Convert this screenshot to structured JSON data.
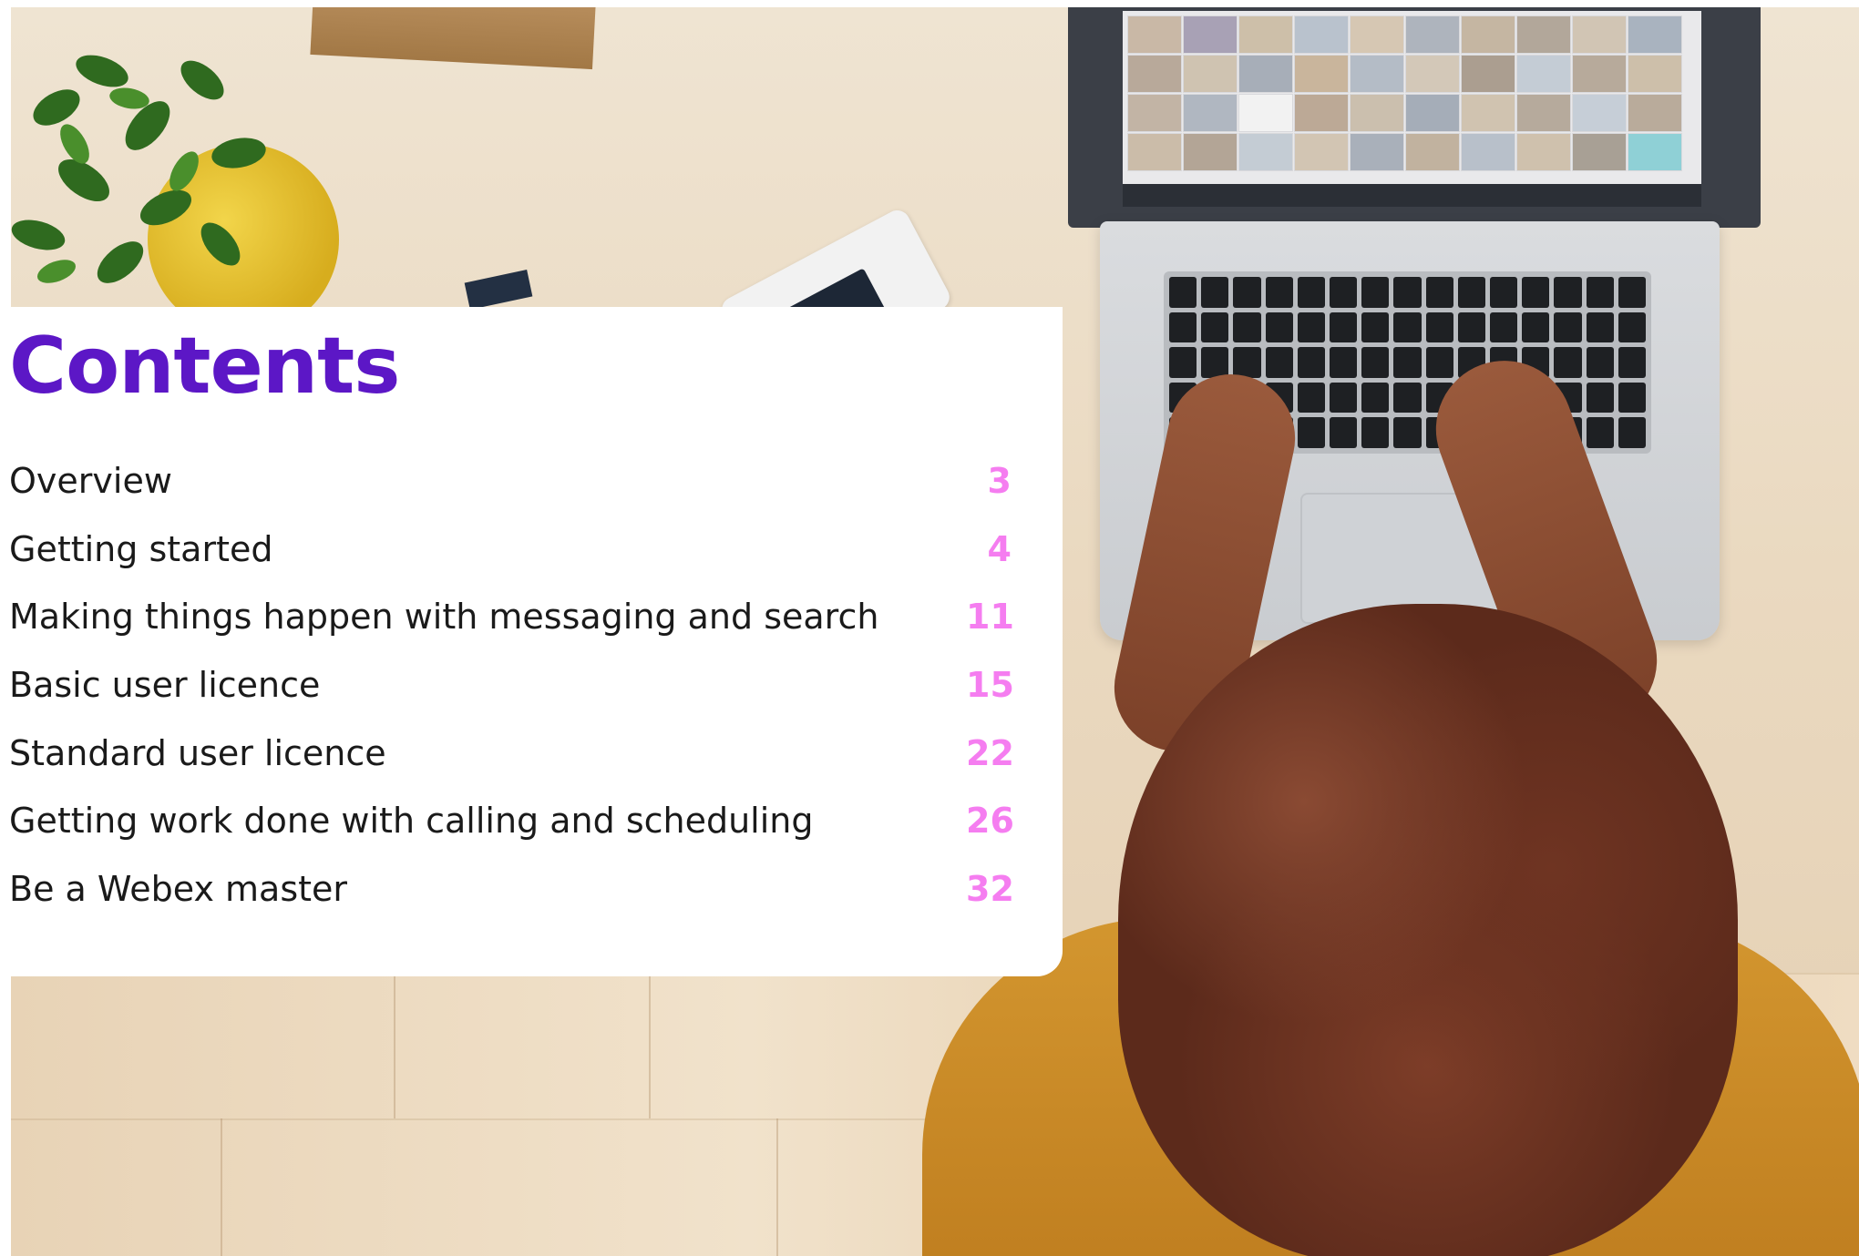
{
  "document": {
    "title": "Contents",
    "toc": [
      {
        "label": "Overview",
        "page": "3"
      },
      {
        "label": "Getting started",
        "page": "4"
      },
      {
        "label": "Making things happen with messaging and search",
        "page": "11"
      },
      {
        "label": "Basic user licence",
        "page": "15"
      },
      {
        "label": "Standard user licence",
        "page": "22"
      },
      {
        "label": "Getting work done with calling and scheduling",
        "page": "26"
      },
      {
        "label": "Be a Webex master",
        "page": "32"
      }
    ]
  },
  "colors": {
    "title": "#5c17c6",
    "page_numbers": "#f57df0",
    "body_text": "#1a1a1a"
  },
  "background_image": {
    "icons": [
      "potted-plant-icon",
      "laptop-icon",
      "video-call-grid-icon",
      "keyboard-icon"
    ]
  }
}
